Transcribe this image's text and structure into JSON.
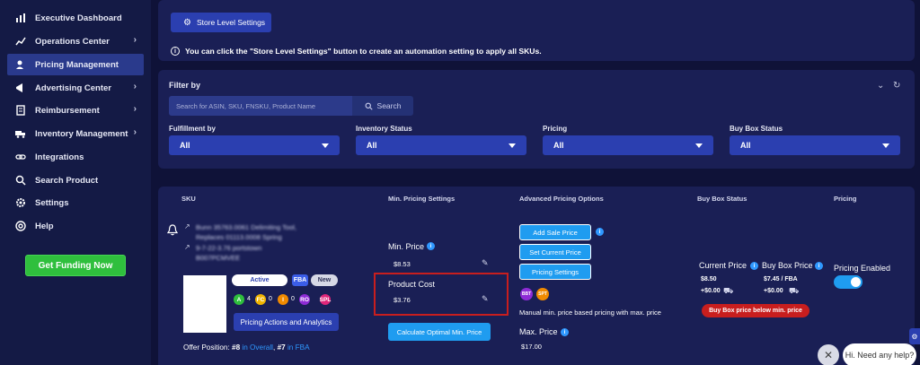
{
  "sidebar": {
    "items": [
      {
        "label": "Executive Dashboard",
        "icon": "chart-bar-icon",
        "chevron": false,
        "active": false
      },
      {
        "label": "Operations Center",
        "icon": "trend-line-icon",
        "chevron": true,
        "active": false
      },
      {
        "label": "Pricing Management",
        "icon": "user-tag-icon",
        "chevron": false,
        "active": true
      },
      {
        "label": "Advertising Center",
        "icon": "megaphone-icon",
        "chevron": true,
        "active": false
      },
      {
        "label": "Reimbursement",
        "icon": "receipt-icon",
        "chevron": true,
        "active": false
      },
      {
        "label": "Inventory Management",
        "icon": "truck-icon",
        "chevron": true,
        "active": false
      },
      {
        "label": "Integrations",
        "icon": "link-icon",
        "chevron": false,
        "active": false
      },
      {
        "label": "Search Product",
        "icon": "search-icon",
        "chevron": false,
        "active": false
      },
      {
        "label": "Settings",
        "icon": "gear-icon",
        "chevron": false,
        "active": false
      },
      {
        "label": "Help",
        "icon": "lifebuoy-icon",
        "chevron": false,
        "active": false
      }
    ],
    "funding_label": "Get Funding Now"
  },
  "store_panel": {
    "button_label": "Store Level Settings",
    "info_text": "You can click the \"Store Level Settings\" button to create an automation setting to apply all SKUs."
  },
  "filter": {
    "title": "Filter by",
    "search_placeholder": "Search for ASIN, SKU, FNSKU, Product Name",
    "search_button": "Search",
    "dropdowns": [
      {
        "label": "Fulfillment by",
        "value": "All"
      },
      {
        "label": "Inventory Status",
        "value": "All"
      },
      {
        "label": "Pricing",
        "value": "All"
      },
      {
        "label": "Buy Box Status",
        "value": "All"
      }
    ]
  },
  "table": {
    "headers": [
      "SKU",
      "Min. Pricing Settings",
      "Advanced Pricing Options",
      "Buy Box Status",
      "Pricing"
    ],
    "row": {
      "title_line1": "Bunn 35763.0061 Delimiting Tool,",
      "title_line2": "Replaces 01113.0008 Spring",
      "sku_line1": "9-7-22-3.76 portstown",
      "sku_line2": "B007PCMVEE",
      "status": "Active",
      "channel": "FBA",
      "condition": "New",
      "badges": [
        {
          "letter": "A",
          "count": "4",
          "color": "#2fbf3d"
        },
        {
          "letter": "FC",
          "count": "0",
          "color": "#f0b400"
        },
        {
          "letter": "I",
          "count": "0",
          "color": "#f08a00"
        },
        {
          "letter": "RO",
          "count": "",
          "color": "#8e2bd6"
        },
        {
          "letter": "SPL",
          "count": "",
          "color": "#e0267a"
        }
      ],
      "actions_label": "Pricing Actions and Analytics",
      "offer_prefix": "Offer Position:",
      "offer_pos1": "#8",
      "offer_link1": "in Overall",
      "offer_sep": ",",
      "offer_pos2": "#7",
      "offer_link2": "in FBA",
      "min_price_label": "Min. Price",
      "min_price_value": "$8.53",
      "product_cost_label": "Product Cost",
      "product_cost_value": "$3.76",
      "calc_button": "Calculate Optimal Min. Price",
      "adv_buttons": [
        "Add Sale Price",
        "Set Current Price",
        "Pricing Settings"
      ],
      "adv_badges": [
        "BBT",
        "SPT"
      ],
      "adv_note": "Manual min. price based pricing with max. price",
      "max_price_label": "Max. Price",
      "max_price_value": "$17.00",
      "current_price_label": "Current Price",
      "current_price_value": "$8.50",
      "current_shipping": "+$0.00",
      "buybox_price_label": "Buy Box Price",
      "buybox_price_value": "$7.45 / FBA",
      "buybox_shipping": "+$0.00",
      "buybox_status": "Buy Box price below min. price",
      "pricing_enabled_label": "Pricing Enabled",
      "pricing_enabled": true
    }
  },
  "help_widget": {
    "close_symbol": "✕",
    "text": "Hi. Need any help?"
  }
}
